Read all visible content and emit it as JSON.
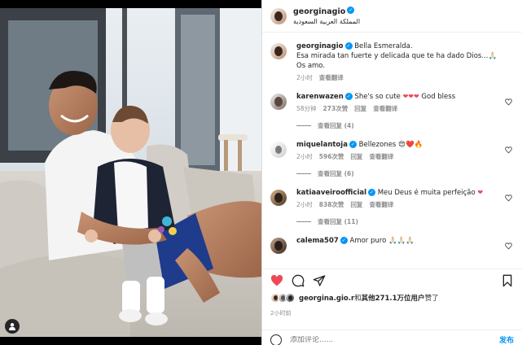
{
  "post": {
    "username": "georginagio",
    "location": "المملكة العربية السعودية",
    "more_label": "•••"
  },
  "caption": {
    "username": "georginagio",
    "text": "Bella Esmeralda.\nEsa mirada tan fuerte y delicada que te ha dado Dios...❤️🙏\nOs amo.",
    "line1": "Bella Esmeralda.",
    "line2": "Esa mirada tan fuerte y delicada que te ha dado Dios...🙏🏻",
    "line3": "Os amo.",
    "time": "2小时",
    "translate": "查看翻译"
  },
  "comments": [
    {
      "username": "karenwazen",
      "text": "She's so cute",
      "suffix": "God bless",
      "time": "58分钟",
      "likes": "273次赞",
      "reply": "回复",
      "translate": "查看翻译",
      "replies": "查看回复 (4)"
    },
    {
      "username": "miquelantoja",
      "text": "Bellezones",
      "time": "2小时",
      "likes": "596次赞",
      "reply": "回复",
      "translate": "查看翻译",
      "replies": "查看回复 (6)"
    },
    {
      "username": "katiaaveiroofficial",
      "text": "Meu Deus é muita perfeição",
      "time": "2小时",
      "likes": "838次赞",
      "reply": "回复",
      "translate": "查看翻译",
      "replies": "查看回复 (11)"
    },
    {
      "username": "calema507",
      "text": "Amor puro 🙏🏻🙏🏻🙏🏻"
    }
  ],
  "likes": {
    "liker": "georgina.gio.r",
    "and": "和",
    "others": "其他271.1万位用户",
    "suffix": "赞了"
  },
  "date": "2小时前",
  "add_comment": {
    "placeholder": "添加评论......",
    "post_label": "发布"
  },
  "colors": {
    "accent": "#0095f6",
    "heart": "#ed4956",
    "muted": "#8e8e8e"
  }
}
